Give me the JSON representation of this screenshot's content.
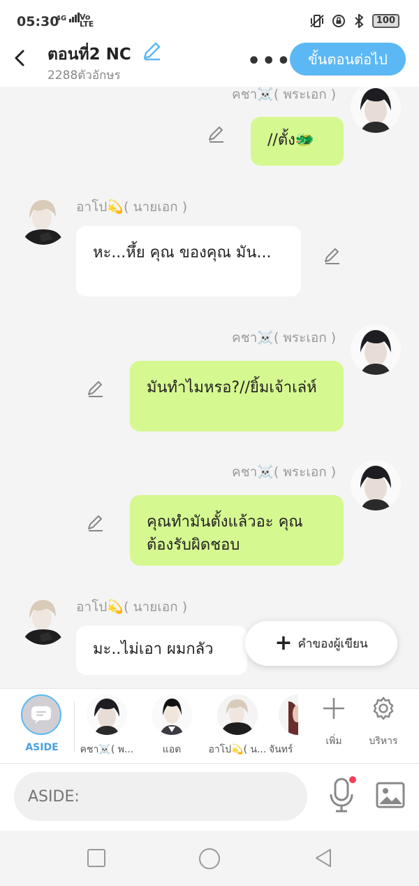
{
  "status_bar": {
    "time": "05:30",
    "net_top": "4G",
    "volte": "Vo\nLTE",
    "battery": "100"
  },
  "header": {
    "title": "ตอนที่2 NC",
    "char_count": "2288ตัวอักษร",
    "more": "•••",
    "next_label": "ขั้นตอนต่อไป"
  },
  "messages": [
    {
      "side": "right",
      "name": "คชา☠️( พระเอก )",
      "text": "//ตั้ง🐲",
      "color": "#d6f891"
    },
    {
      "side": "left",
      "name": "อาโป💫( นายเอก )",
      "text": "หะ...หึ้ย คุณ ของคุณ มัน...",
      "color": "#ffffff"
    },
    {
      "side": "right",
      "name": "คชา☠️( พระเอก )",
      "text": "มันทำไมหรอ?//ยิ้มเจ้าเล่ห์",
      "color": "#d6f891"
    },
    {
      "side": "right",
      "name": "คชา☠️( พระเอก )",
      "text": "คุณทำมันตั้งแล้วอะ คุณต้องรับผิดชอบ",
      "color": "#d6f891"
    },
    {
      "side": "left",
      "name": "อาโป💫( นายเอก )",
      "text": "มะ..ไม่เอา ผมกลัว",
      "color": "#ffffff"
    }
  ],
  "writer_button": {
    "plus": "+",
    "label": "คำของผู้เขียน"
  },
  "characters": {
    "aside_label": "ASIDE",
    "items": [
      {
        "label": "คชา☠️( พ..."
      },
      {
        "label": "แอต"
      },
      {
        "label": "อาโป💫( น..."
      },
      {
        "label": "จันทร์"
      }
    ],
    "add_label": "เพิ่ม",
    "manage_label": "บริหาร"
  },
  "input": {
    "placeholder": "ASIDE:"
  },
  "colors": {
    "accent": "#5cb8f4",
    "green_bubble": "#d6f891",
    "record_dot": "#f0405a"
  }
}
